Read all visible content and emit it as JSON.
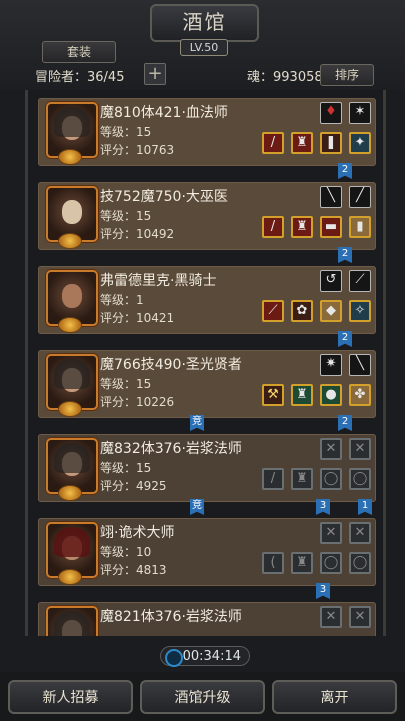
{
  "header": {
    "title": "酒馆",
    "level": "LV.50",
    "set_button": "套装",
    "adventurers_label": "冒险者：36/45",
    "add_symbol": "+",
    "soul_label": "魂：993058",
    "sort_button": "排序"
  },
  "cards": [
    {
      "name": "魔810体421·血法师",
      "level": "等级：15",
      "score": "评分：10763"
    },
    {
      "name": "技752魔750·大巫医",
      "level": "等级：15",
      "score": "评分：10492"
    },
    {
      "name": "弗雷德里克·黑骑士",
      "level": "等级：1",
      "score": "评分：10421"
    },
    {
      "name": "魔766技490·圣光贤者",
      "level": "等级：15",
      "score": "评分：10226"
    },
    {
      "name": "魔832体376·岩浆法师",
      "level": "等级：15",
      "score": "评分：4925"
    },
    {
      "name": "翊·诡术大师",
      "level": "等级：10",
      "score": "评分：4813"
    },
    {
      "name": "魔821体376·岩浆法师",
      "level": "",
      "score": ""
    }
  ],
  "tags": {
    "t2": "2",
    "t3": "3",
    "t1": "1",
    "compete": "竞"
  },
  "timer": "00:34:14",
  "bottom": {
    "recruit": "新人招募",
    "upgrade": "酒馆升级",
    "leave": "离开"
  }
}
